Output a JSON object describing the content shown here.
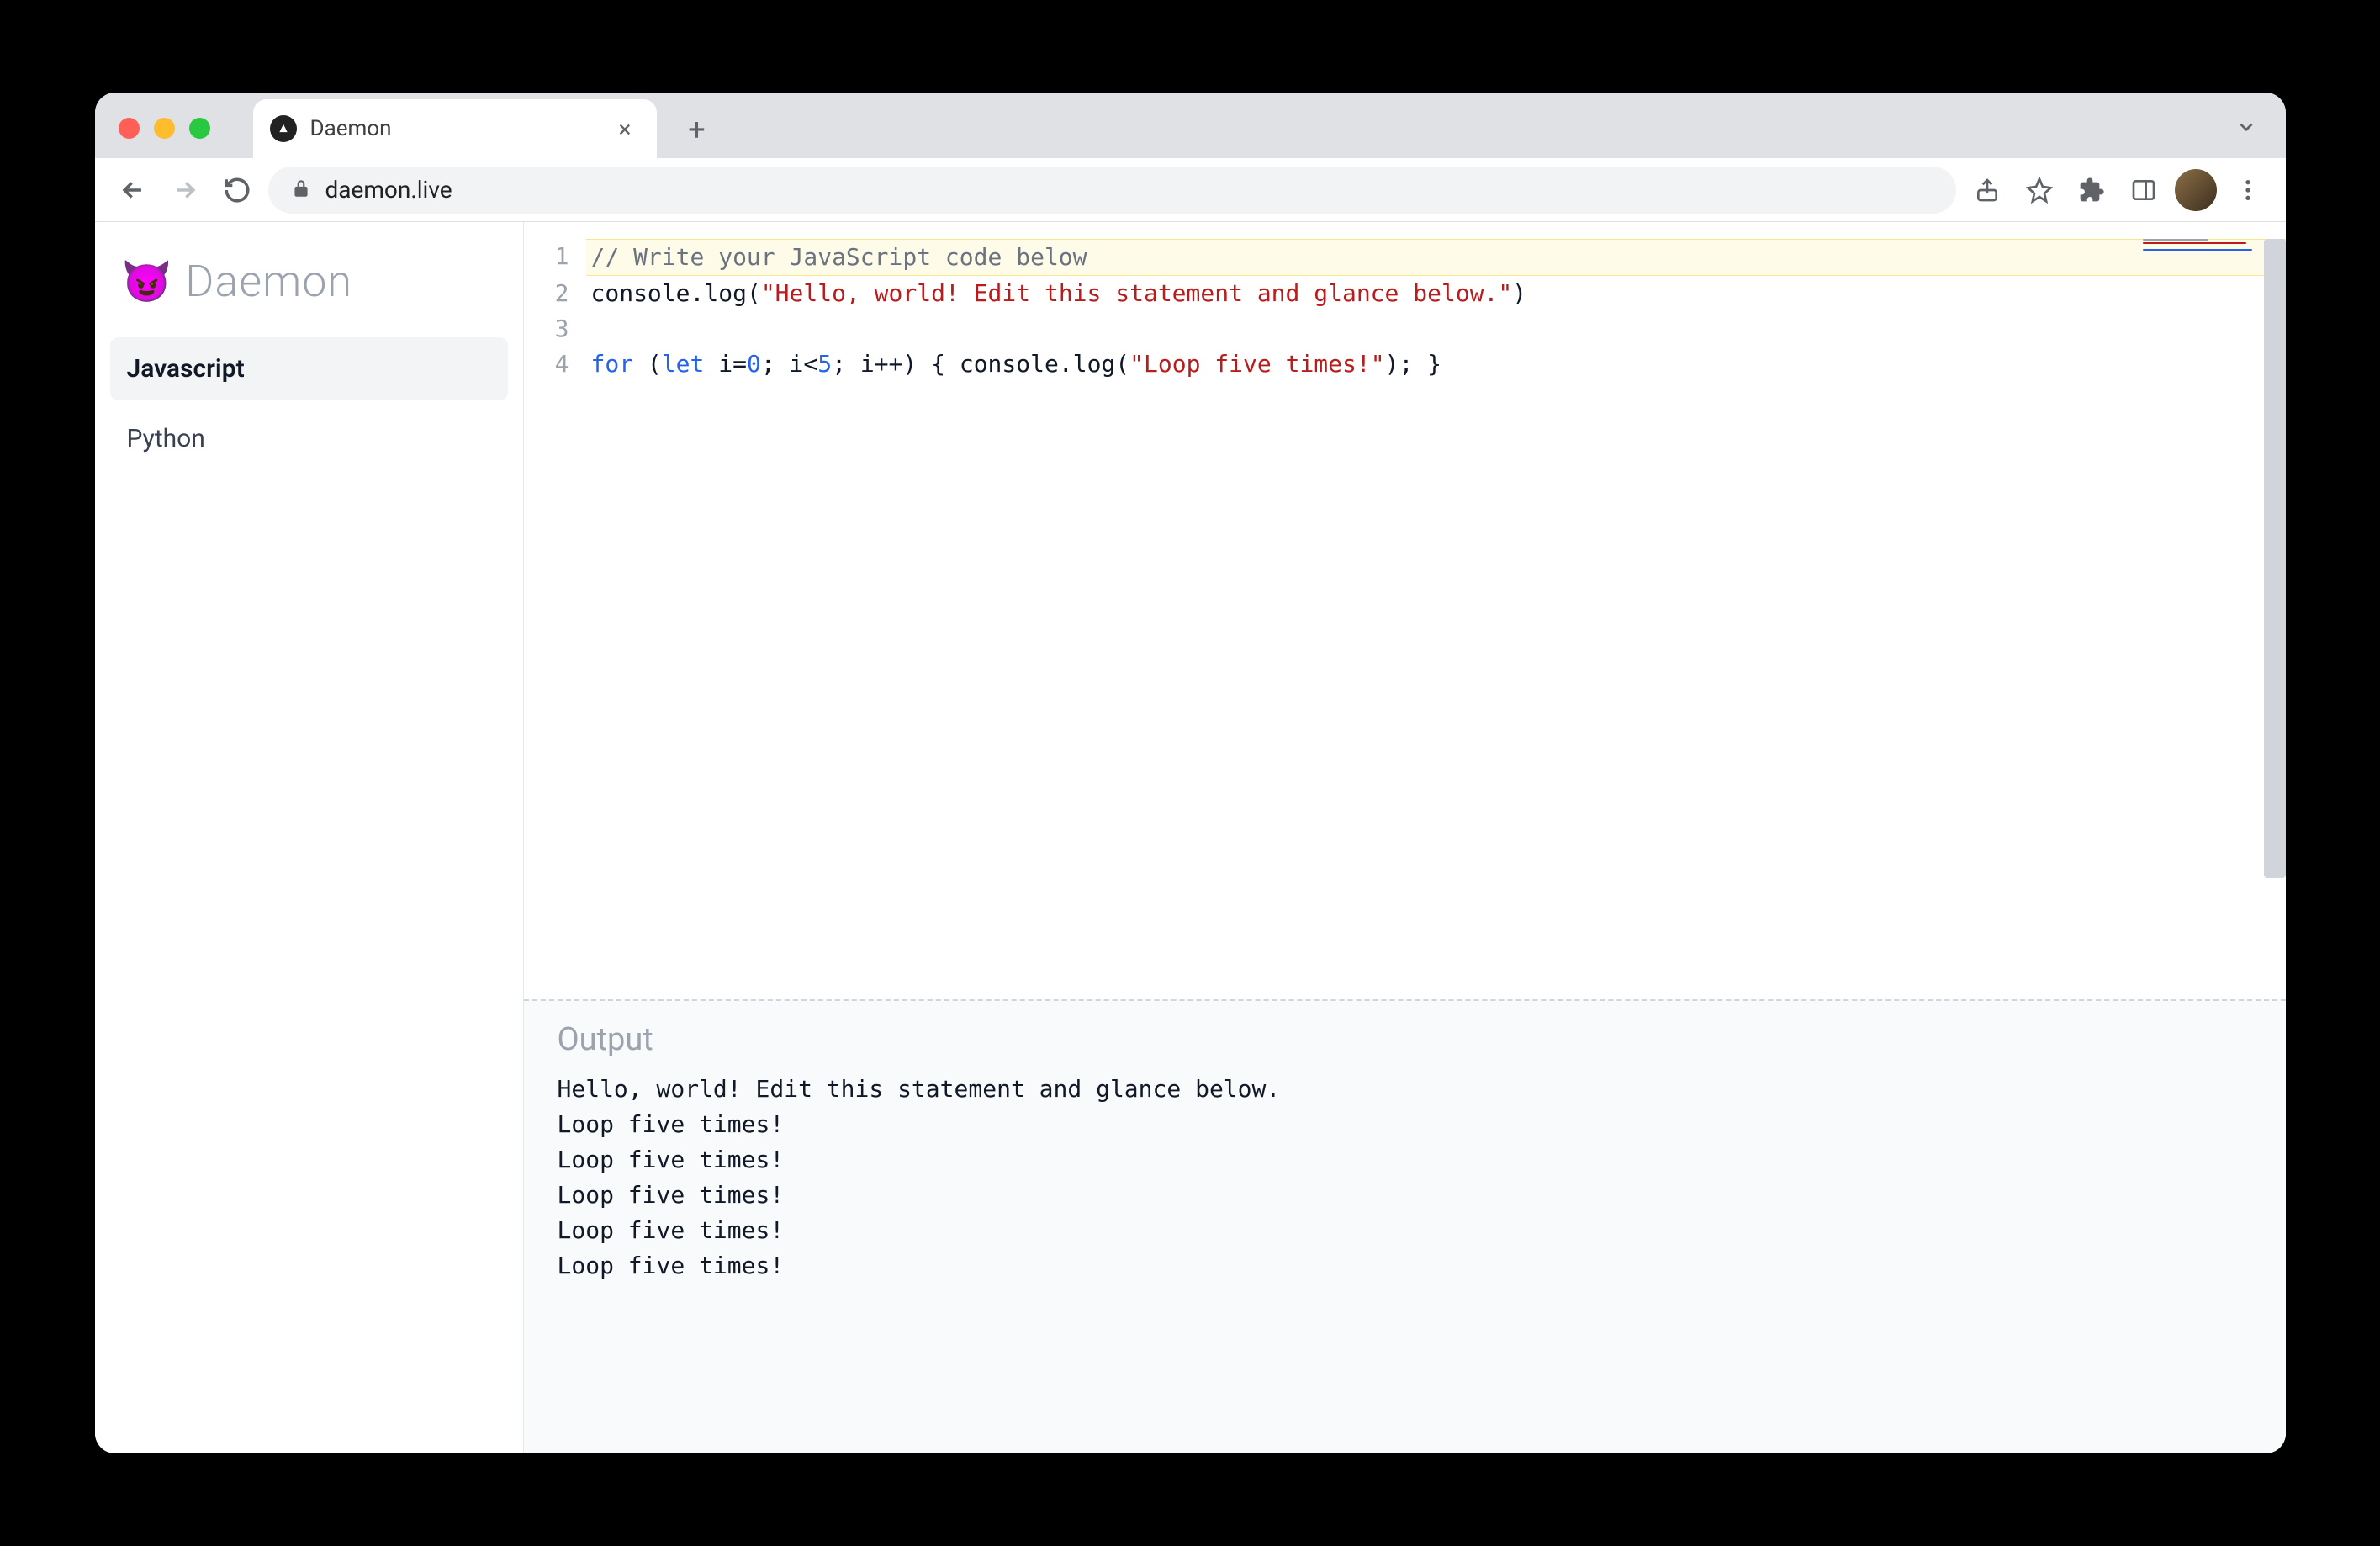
{
  "browser": {
    "tab_title": "Daemon",
    "url": "daemon.live"
  },
  "app": {
    "logo_emoji": "😈",
    "logo_text": "Daemon",
    "sidebar": {
      "items": [
        {
          "label": "Javascript",
          "active": true
        },
        {
          "label": "Python",
          "active": false
        }
      ]
    }
  },
  "editor": {
    "lines": [
      {
        "num": "1",
        "highlight": true,
        "tokens": [
          {
            "t": "// Write your JavaScript code below",
            "c": "tok-comment"
          }
        ]
      },
      {
        "num": "2",
        "highlight": false,
        "tokens": [
          {
            "t": "console",
            "c": "tok-id"
          },
          {
            "t": ".",
            "c": "tok-punct"
          },
          {
            "t": "log",
            "c": "tok-id"
          },
          {
            "t": "(",
            "c": "tok-punct"
          },
          {
            "t": "\"Hello, world! Edit this statement and glance below.\"",
            "c": "tok-string"
          },
          {
            "t": ")",
            "c": "tok-punct"
          }
        ]
      },
      {
        "num": "3",
        "highlight": false,
        "tokens": []
      },
      {
        "num": "4",
        "highlight": false,
        "tokens": [
          {
            "t": "for",
            "c": "tok-keyword"
          },
          {
            "t": " (",
            "c": "tok-punct"
          },
          {
            "t": "let",
            "c": "tok-decl"
          },
          {
            "t": " i",
            "c": "tok-id"
          },
          {
            "t": "=",
            "c": "tok-punct"
          },
          {
            "t": "0",
            "c": "tok-num"
          },
          {
            "t": "; i",
            "c": "tok-id"
          },
          {
            "t": "<",
            "c": "tok-punct"
          },
          {
            "t": "5",
            "c": "tok-num"
          },
          {
            "t": "; i",
            "c": "tok-id"
          },
          {
            "t": "++",
            "c": "tok-punct"
          },
          {
            "t": ") { ",
            "c": "tok-punct"
          },
          {
            "t": "console",
            "c": "tok-id"
          },
          {
            "t": ".",
            "c": "tok-punct"
          },
          {
            "t": "log",
            "c": "tok-id"
          },
          {
            "t": "(",
            "c": "tok-punct"
          },
          {
            "t": "\"Loop five times!\"",
            "c": "tok-string"
          },
          {
            "t": "); }",
            "c": "tok-punct"
          }
        ]
      }
    ]
  },
  "output": {
    "heading": "Output",
    "lines": [
      "Hello, world! Edit this statement and glance below.",
      "Loop five times!",
      "Loop five times!",
      "Loop five times!",
      "Loop five times!",
      "Loop five times!"
    ]
  }
}
